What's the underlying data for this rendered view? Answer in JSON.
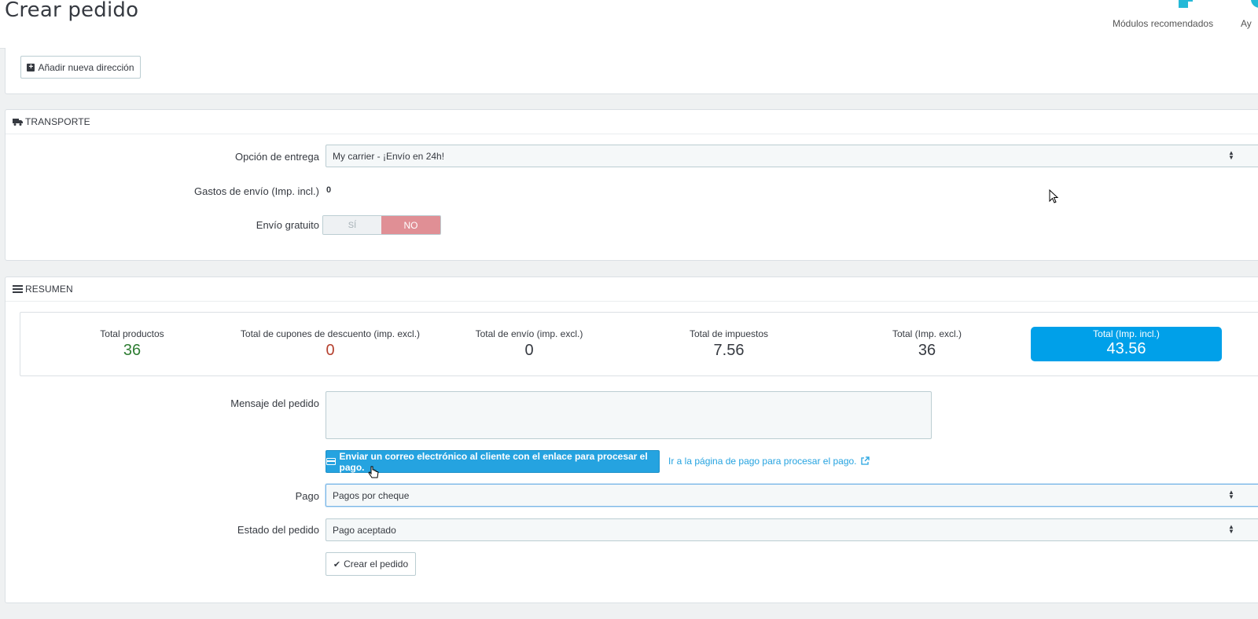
{
  "header": {
    "title": "Crear pedido",
    "recommended_modules": "Módulos recomendados",
    "help": "Ay"
  },
  "addresses": {
    "add_address_button": "Añadir nueva dirección"
  },
  "transport": {
    "heading": "TRANSPORTE",
    "delivery_option_label": "Opción de entrega",
    "delivery_option_value": "My carrier - ¡Envío en 24h!",
    "shipping_cost_label": "Gastos de envío (Imp. incl.)",
    "shipping_cost_value": "0",
    "free_shipping_label": "Envío gratuito",
    "free_shipping_yes": "SÍ",
    "free_shipping_no": "NO",
    "free_shipping_selected": "NO"
  },
  "summary": {
    "heading": "RESUMEN",
    "totals": [
      {
        "label": "Total productos",
        "value": "36",
        "color": "#2e7d32"
      },
      {
        "label": "Total de cupones de descuento (imp. excl.)",
        "value": "0",
        "color": "#b5412f"
      },
      {
        "label": "Total de envío (imp. excl.)",
        "value": "0",
        "color": "#363a41"
      },
      {
        "label": "Total de impuestos",
        "value": "7.56",
        "color": "#363a41"
      },
      {
        "label": "Total (Imp. excl.)",
        "value": "36",
        "color": "#363a41"
      },
      {
        "label": "Total (Imp. incl.)",
        "value": "43.56",
        "color": "#ffffff"
      }
    ],
    "message_label": "Mensaje del pedido",
    "message_value": "",
    "send_email_button": "Enviar un correo electrónico al cliente con el enlace para procesar el pago.",
    "payment_page_link": "Ir a la página de pago para procesar el pago.",
    "payment_label": "Pago",
    "payment_value": "Pagos por cheque",
    "order_state_label": "Estado del pedido",
    "order_state_value": "Pago aceptado",
    "create_order_button": "Crear el pedido"
  },
  "colors": {
    "primary": "#25a3e0",
    "toggle_no": "#e08f95",
    "page_bg": "#eff1f2"
  }
}
